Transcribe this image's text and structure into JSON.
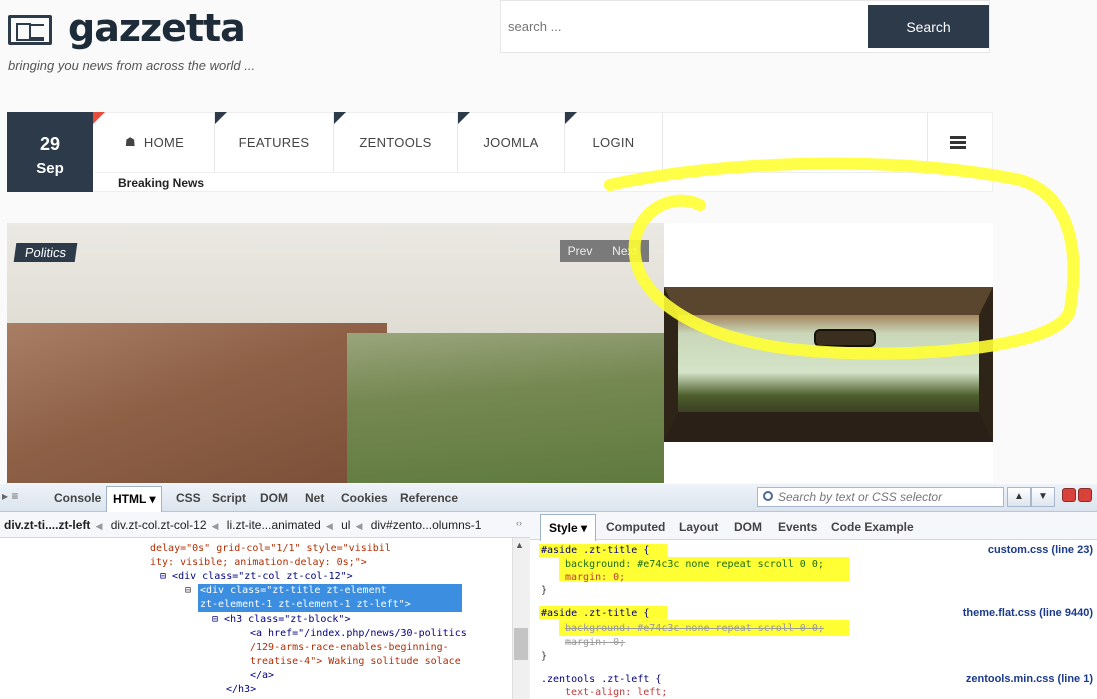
{
  "site": {
    "name": "gazzetta",
    "tagline": "bringing you news from across the world ...",
    "search_placeholder": "search ...",
    "search_button": "Search"
  },
  "date": {
    "day": "29",
    "month": "Sep"
  },
  "nav": {
    "items": [
      "HOME",
      "FEATURES",
      "ZENTOOLS",
      "JOOMLA",
      "LOGIN"
    ],
    "breaking": "Breaking News"
  },
  "slider": {
    "category": "Politics",
    "prev": "Prev",
    "next": "Next"
  },
  "devtools": {
    "tabs": [
      "Console",
      "HTML",
      "CSS",
      "Script",
      "DOM",
      "Net",
      "Cookies",
      "Reference"
    ],
    "active_tab": "HTML",
    "search_placeholder": "Search by text or CSS selector",
    "breadcrumbs": [
      "div.zt-ti....zt-left",
      "div.zt-col.zt-col-12",
      "li.zt-ite...animated",
      "ul",
      "div#zento...olumns-1"
    ],
    "side_tabs": [
      "Style",
      "Computed",
      "Layout",
      "DOM",
      "Events",
      "Code Example"
    ],
    "html_lines": [
      "delay=\"0s\" grid-col=\"1/1\" style=\"visibil",
      "ity: visible; animation-delay: 0s;\">",
      "<div class=\"zt-col zt-col-12\">",
      "<div class=\"zt-title zt-element",
      "zt-element-1 zt-element-1 zt-left\">",
      "<h3 class=\"zt-block\">",
      "<a href=\"/index.php/news/30-politics",
      "/129-arms-race-enables-beginning-",
      "treatise-4\"> Waking solitude solace",
      "</a>",
      "</h3>"
    ],
    "css_rules": [
      {
        "selector": "#aside .zt-title {",
        "source": "custom.css (line 23)",
        "bg": "background: #e74c3c none repeat scroll 0 0;",
        "margin": "margin: 0;"
      },
      {
        "selector": "#aside .zt-title {",
        "source": "theme.flat.css (line 9440)",
        "bg": "background: #e74c3c none repeat scroll 0 0;",
        "margin": "margin: 0;"
      },
      {
        "selector": ".zentools .zt-left {",
        "source": "zentools.min.css (line 1)",
        "bg": "text-align: left;"
      }
    ]
  },
  "colors": {
    "brand": "#2c3a4a",
    "accent": "#e74c3c",
    "highlight": "#ffff33"
  }
}
